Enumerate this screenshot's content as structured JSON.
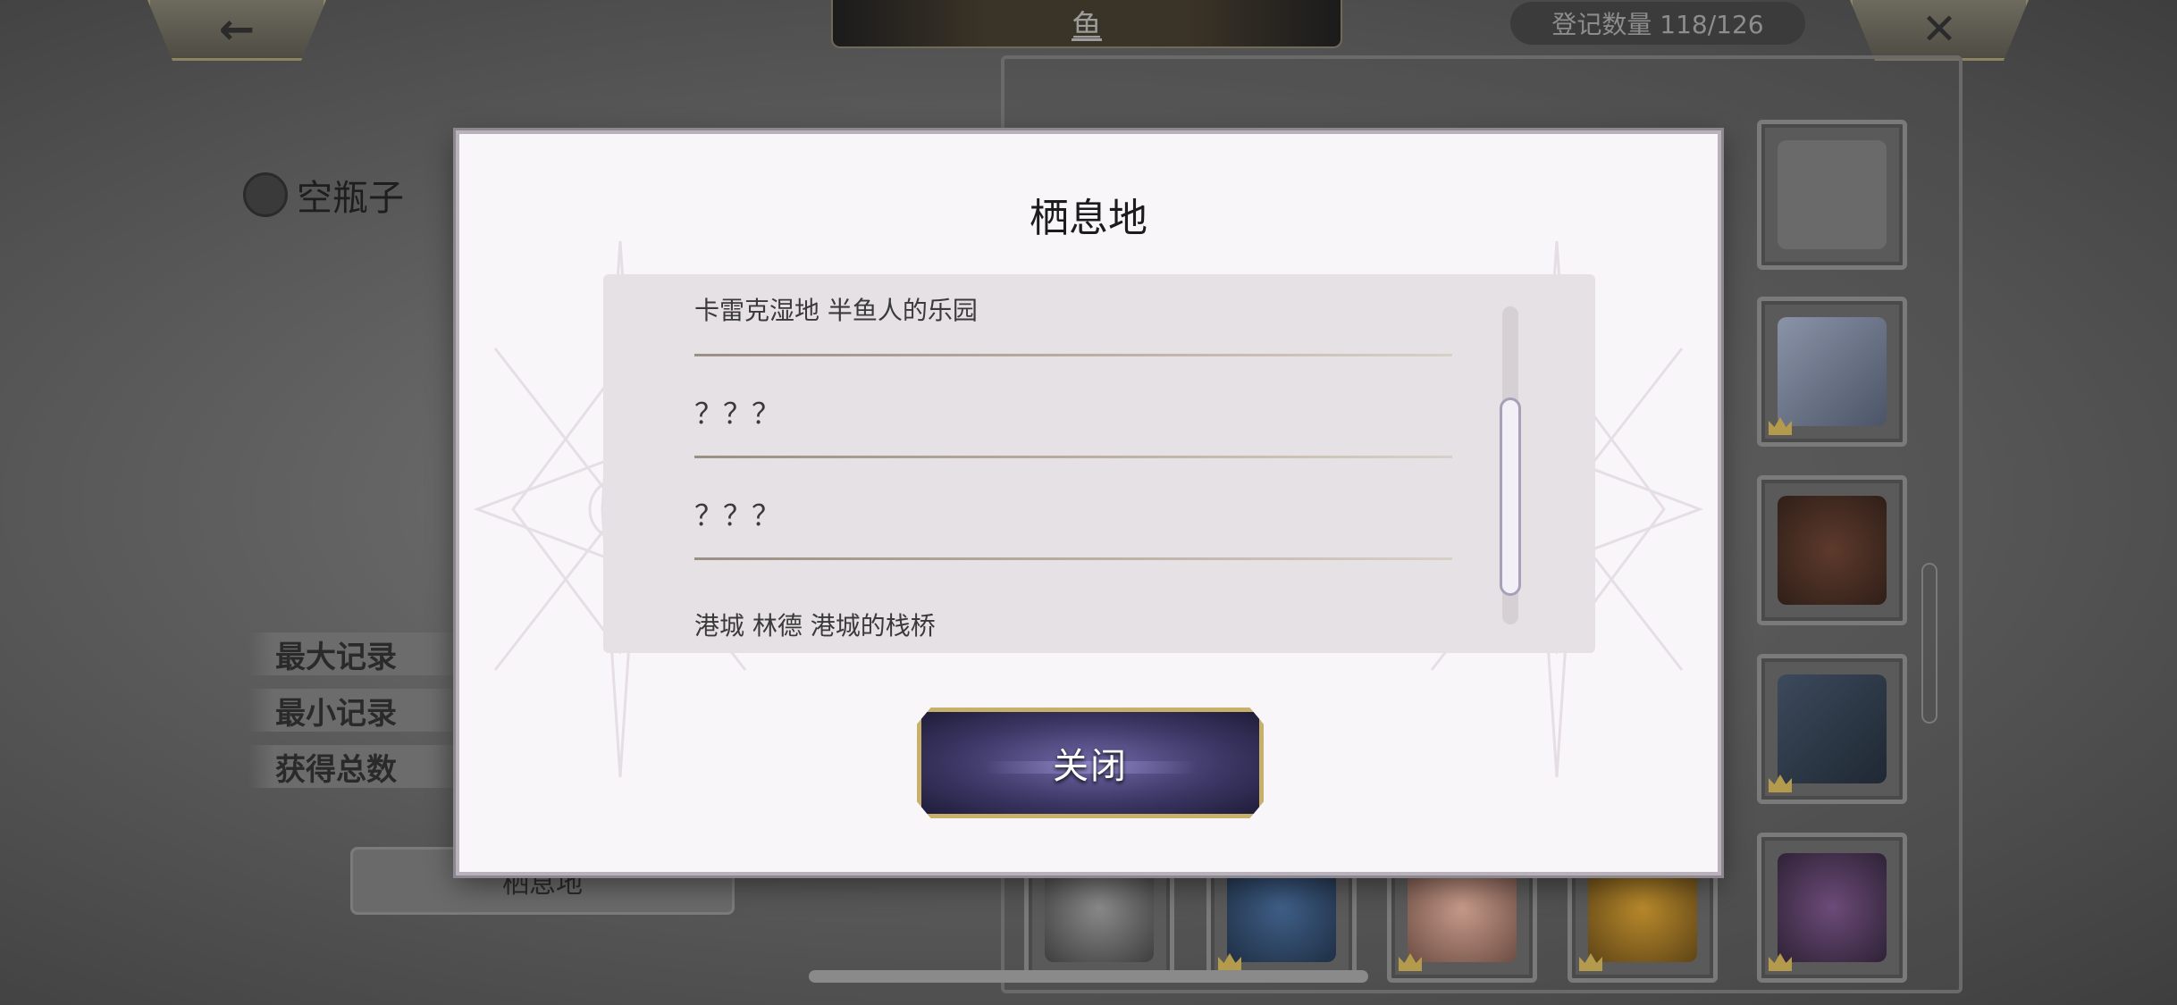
{
  "header": {
    "back_icon": "←",
    "title": "鱼",
    "register_count": "登记数量 118/126",
    "close_icon": "✕"
  },
  "item": {
    "name": "空瓶子"
  },
  "stats": {
    "max_record": "最大记录",
    "min_record": "最小记录",
    "total_obtained": "获得总数"
  },
  "habitat_tab_label": "栖息地",
  "modal": {
    "title": "栖息地",
    "habitats": [
      "卡雷克湿地 半鱼人的乐园",
      "？？？",
      "？？？",
      "港城 林德 港城的栈桥"
    ],
    "close_button": "关闭"
  },
  "colors": {
    "modal_bg": "#f8f6f9",
    "list_bg": "#e6e1e4",
    "button_fill": "#3d3866",
    "button_border": "#c7b06a"
  }
}
